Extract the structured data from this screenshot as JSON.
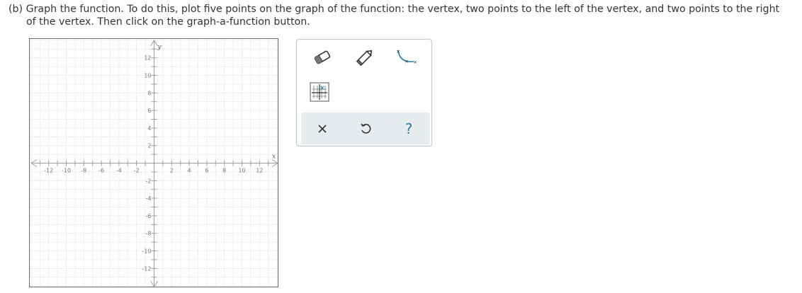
{
  "instruction": {
    "line1": "(b) Graph the function. To do this, plot five points on the graph of the function: the vertex, two points to the left of the vertex, and two points to the right",
    "line2": "of the vertex. Then click on the graph-a-function button."
  },
  "graph": {
    "x_axis_label": "x",
    "y_axis_label": "y",
    "x_range": [
      -14,
      14
    ],
    "y_range": [
      -14,
      14
    ],
    "x_tick_labels": [
      "-12",
      "-10",
      "-8",
      "-6",
      "-4",
      "-2",
      "2",
      "4",
      "6",
      "8",
      "10",
      "12"
    ],
    "y_tick_labels": [
      "12",
      "10",
      "8",
      "6",
      "4",
      "2",
      "-2",
      "-4",
      "-6",
      "-8",
      "-10",
      "-12"
    ]
  },
  "tools": {
    "eraser": "eraser-icon",
    "pencil": "pencil-icon",
    "curve": "parabola-curve-icon",
    "table": "point-table-icon"
  },
  "actions": {
    "clear": "×",
    "undo": "undo-icon",
    "help": "?"
  },
  "colors": {
    "accent": "#2a7fa8",
    "grid": "#d9d9d9",
    "axis": "#9aa0a6",
    "panel_bg": "#e6ebee"
  }
}
